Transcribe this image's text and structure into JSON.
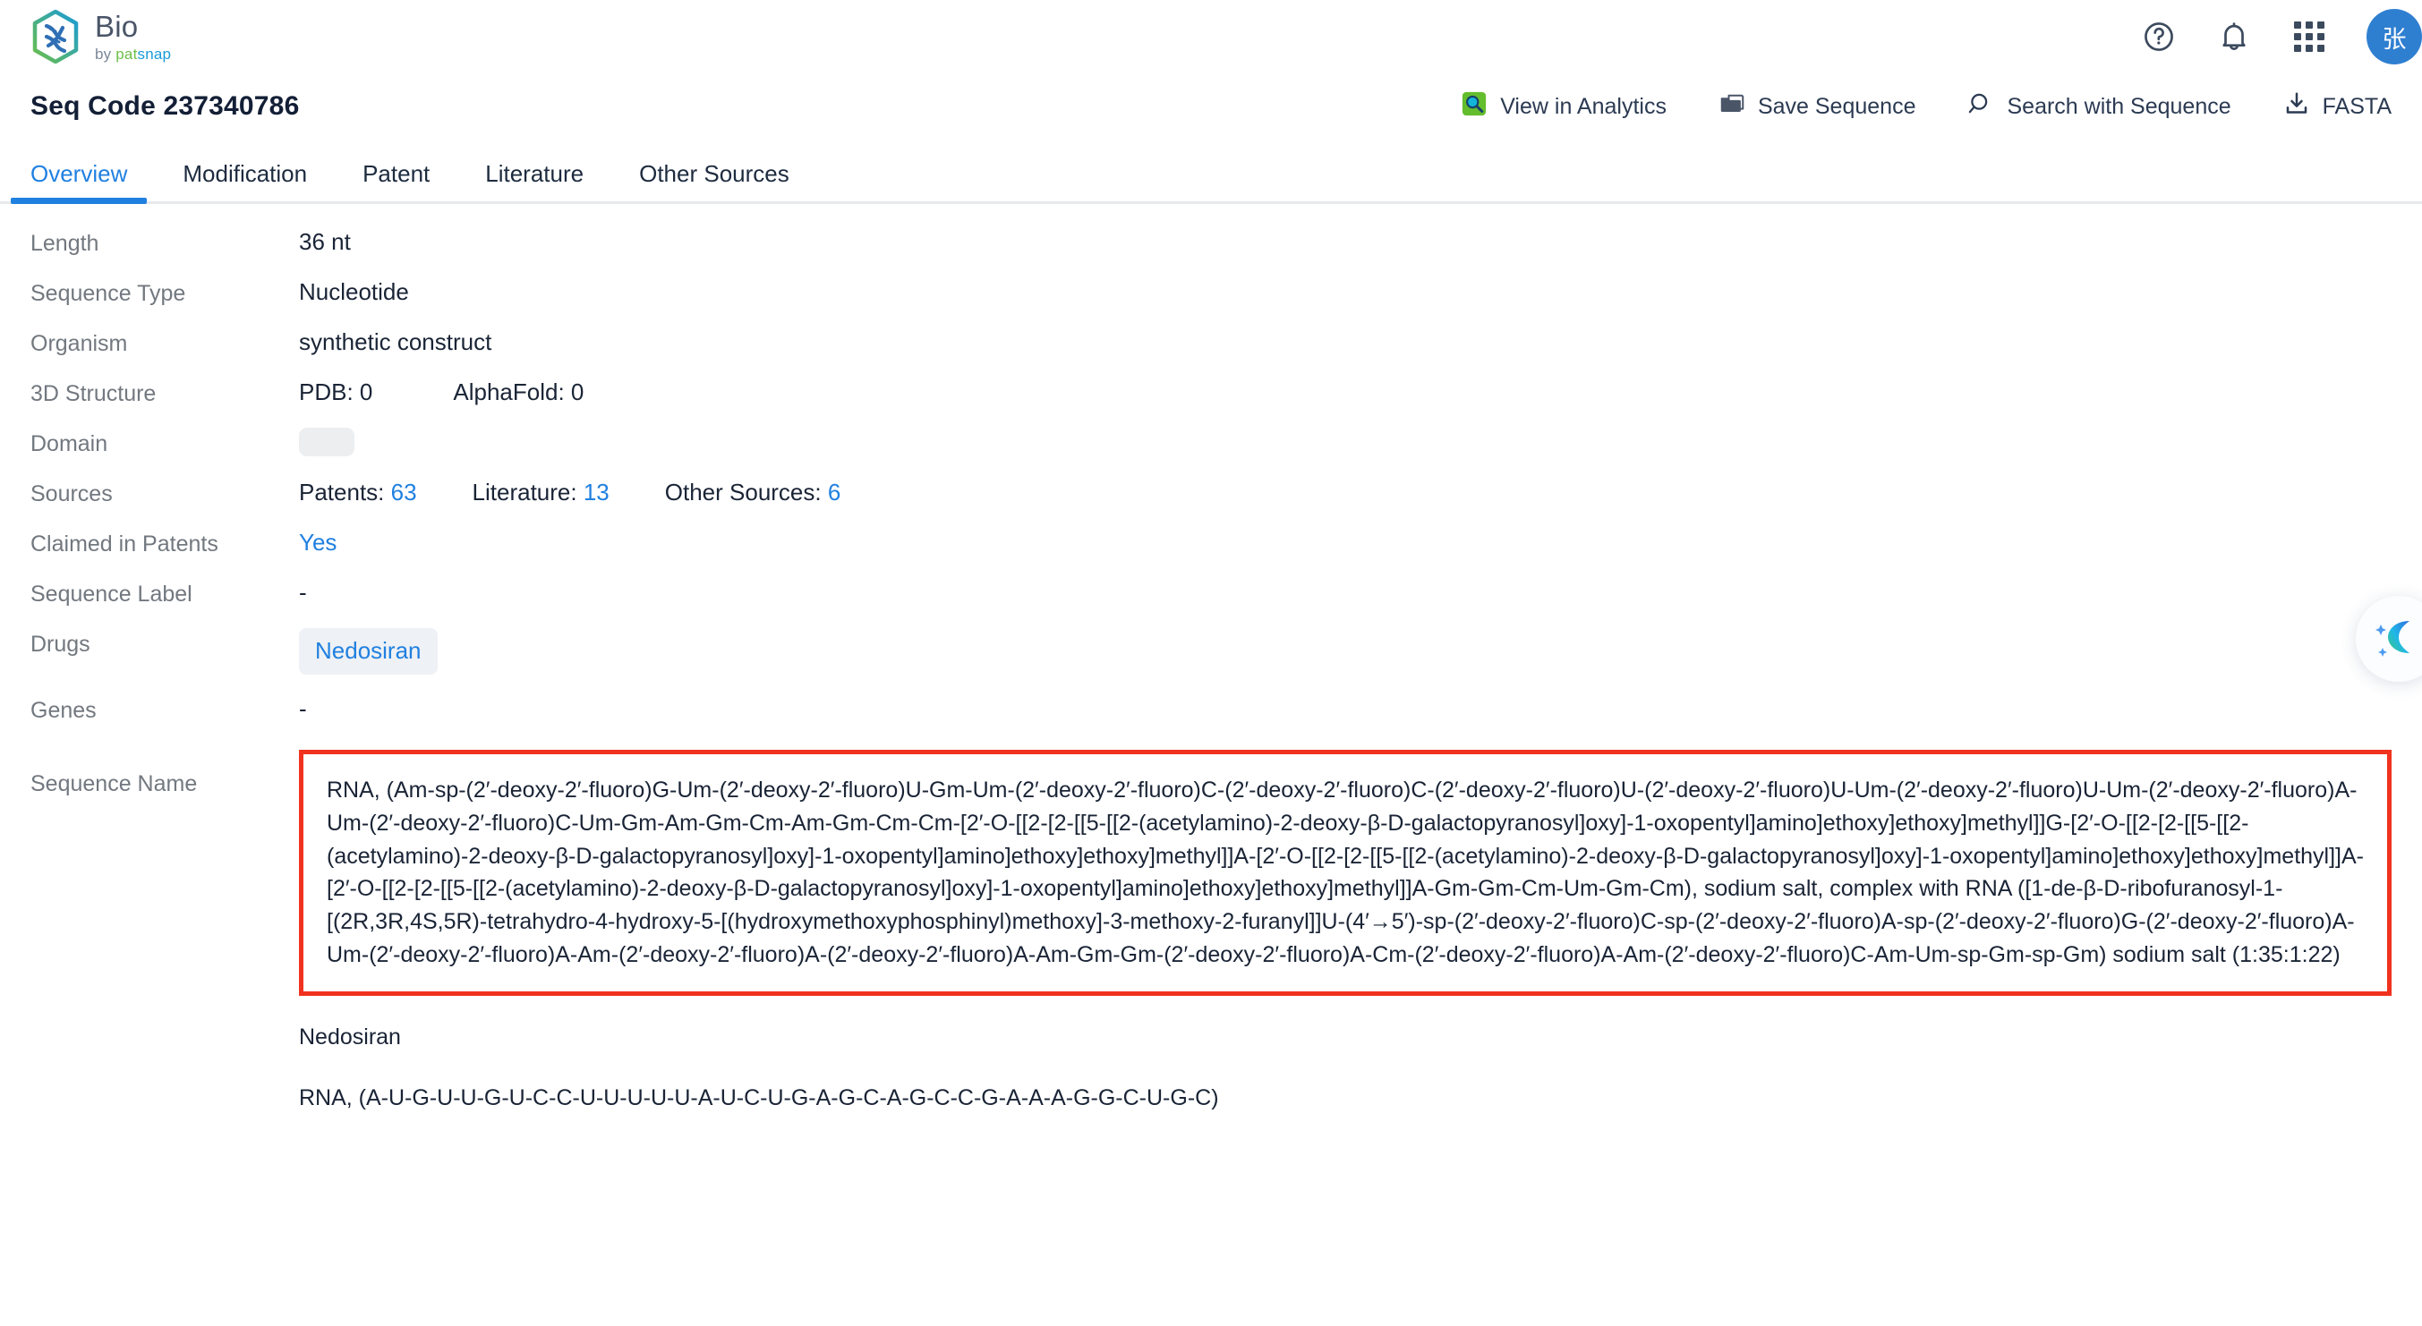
{
  "brand": {
    "title": "Bio",
    "by": "by ",
    "pat": "pat",
    "snap": "snap",
    "logo_colors": {
      "green": "#6cbf4b",
      "blue": "#1a9bd7",
      "dna": "#2f6fb5"
    }
  },
  "header": {
    "help_icon": "help-circle-icon",
    "bell_icon": "notification-bell-icon",
    "apps_icon": "apps-grid-icon",
    "avatar_initial": "张",
    "avatar_color": "#2f7fd1"
  },
  "page": {
    "title": "Seq Code 237340786"
  },
  "actions": [
    {
      "label": "View in Analytics",
      "icon": "analytics-search-icon"
    },
    {
      "label": "Save Sequence",
      "icon": "folder-icon"
    },
    {
      "label": "Search with Sequence",
      "icon": "search-icon"
    },
    {
      "label": "FASTA",
      "icon": "download-icon"
    }
  ],
  "tabs": [
    {
      "label": "Overview",
      "active": true
    },
    {
      "label": "Modification",
      "active": false
    },
    {
      "label": "Patent",
      "active": false
    },
    {
      "label": "Literature",
      "active": false
    },
    {
      "label": "Other Sources",
      "active": false
    }
  ],
  "fields": {
    "length": {
      "label": "Length",
      "value": "36 nt"
    },
    "sequence_type": {
      "label": "Sequence Type",
      "value": "Nucleotide"
    },
    "organism": {
      "label": "Organism",
      "value": "synthetic construct"
    },
    "structure_3d": {
      "label": "3D Structure",
      "pdb": "PDB: 0",
      "alphafold": "AlphaFold: 0"
    },
    "domain": {
      "label": "Domain",
      "value": ""
    },
    "sources": {
      "label": "Sources",
      "patents_label": "Patents: ",
      "patents_count": "63",
      "literature_label": "Literature: ",
      "literature_count": "13",
      "other_label": "Other Sources: ",
      "other_count": "6"
    },
    "claimed": {
      "label": "Claimed in Patents",
      "value": "Yes"
    },
    "sequence_label": {
      "label": "Sequence Label",
      "value": "-"
    },
    "drugs": {
      "label": "Drugs",
      "value": "Nedosiran"
    },
    "genes": {
      "label": "Genes",
      "value": "-"
    },
    "sequence_name": {
      "label": "Sequence Name",
      "highlighted": "RNA, (Am-sp-(2′-deoxy-2′-fluoro)G-Um-(2′-deoxy-2′-fluoro)U-Gm-Um-(2′-deoxy-2′-fluoro)C-(2′-deoxy-2′-fluoro)C-(2′-deoxy-2′-fluoro)U-(2′-deoxy-2′-fluoro)U-Um-(2′-deoxy-2′-fluoro)U-Um-(2′-deoxy-2′-fluoro)A-Um-(2′-deoxy-2′-fluoro)C-Um-Gm-Am-Gm-Cm-Am-Gm-Cm-Cm-[2′-O-[[2-[2-[[5-[[2-(acetylamino)-2-deoxy-β-D-galactopyranosyl]oxy]-1-oxopentyl]amino]ethoxy]ethoxy]methyl]]G-[2′-O-[[2-[2-[[5-[[2-(acetylamino)-2-deoxy-β-D-galactopyranosyl]oxy]-1-oxopentyl]amino]ethoxy]ethoxy]methyl]]A-[2′-O-[[2-[2-[[5-[[2-(acetylamino)-2-deoxy-β-D-galactopyranosyl]oxy]-1-oxopentyl]amino]ethoxy]ethoxy]methyl]]A-[2′-O-[[2-[2-[[5-[[2-(acetylamino)-2-deoxy-β-D-galactopyranosyl]oxy]-1-oxopentyl]amino]ethoxy]ethoxy]methyl]]A-Gm-Gm-Cm-Um-Gm-Cm), sodium salt, complex with RNA ([1-de-β-D-ribofuranosyl-1-[(2R,3R,4S,5R)-tetrahydro-4-hydroxy-5-[(hydroxymethoxyphosphinyl)methoxy]-3-methoxy-2-furanyl]]U-(4′→5′)-sp-(2′-deoxy-2′-fluoro)C-sp-(2′-deoxy-2′-fluoro)A-sp-(2′-deoxy-2′-fluoro)G-(2′-deoxy-2′-fluoro)A-Um-(2′-deoxy-2′-fluoro)A-Am-(2′-deoxy-2′-fluoro)A-(2′-deoxy-2′-fluoro)A-Am-Gm-Gm-(2′-deoxy-2′-fluoro)A-Cm-(2′-deoxy-2′-fluoro)A-Am-(2′-deoxy-2′-fluoro)C-Am-Um-sp-Gm-sp-Gm) sodium salt (1:35:1:22)",
      "alias": "Nedosiran",
      "plain_sequence": "RNA, (A-U-G-U-U-G-U-C-C-U-U-U-U-U-A-U-C-U-G-A-G-C-A-G-C-C-G-A-A-A-G-G-C-U-G-C)"
    }
  },
  "ai_widget": {
    "icon": "ai-assistant-sparkle-icon"
  }
}
